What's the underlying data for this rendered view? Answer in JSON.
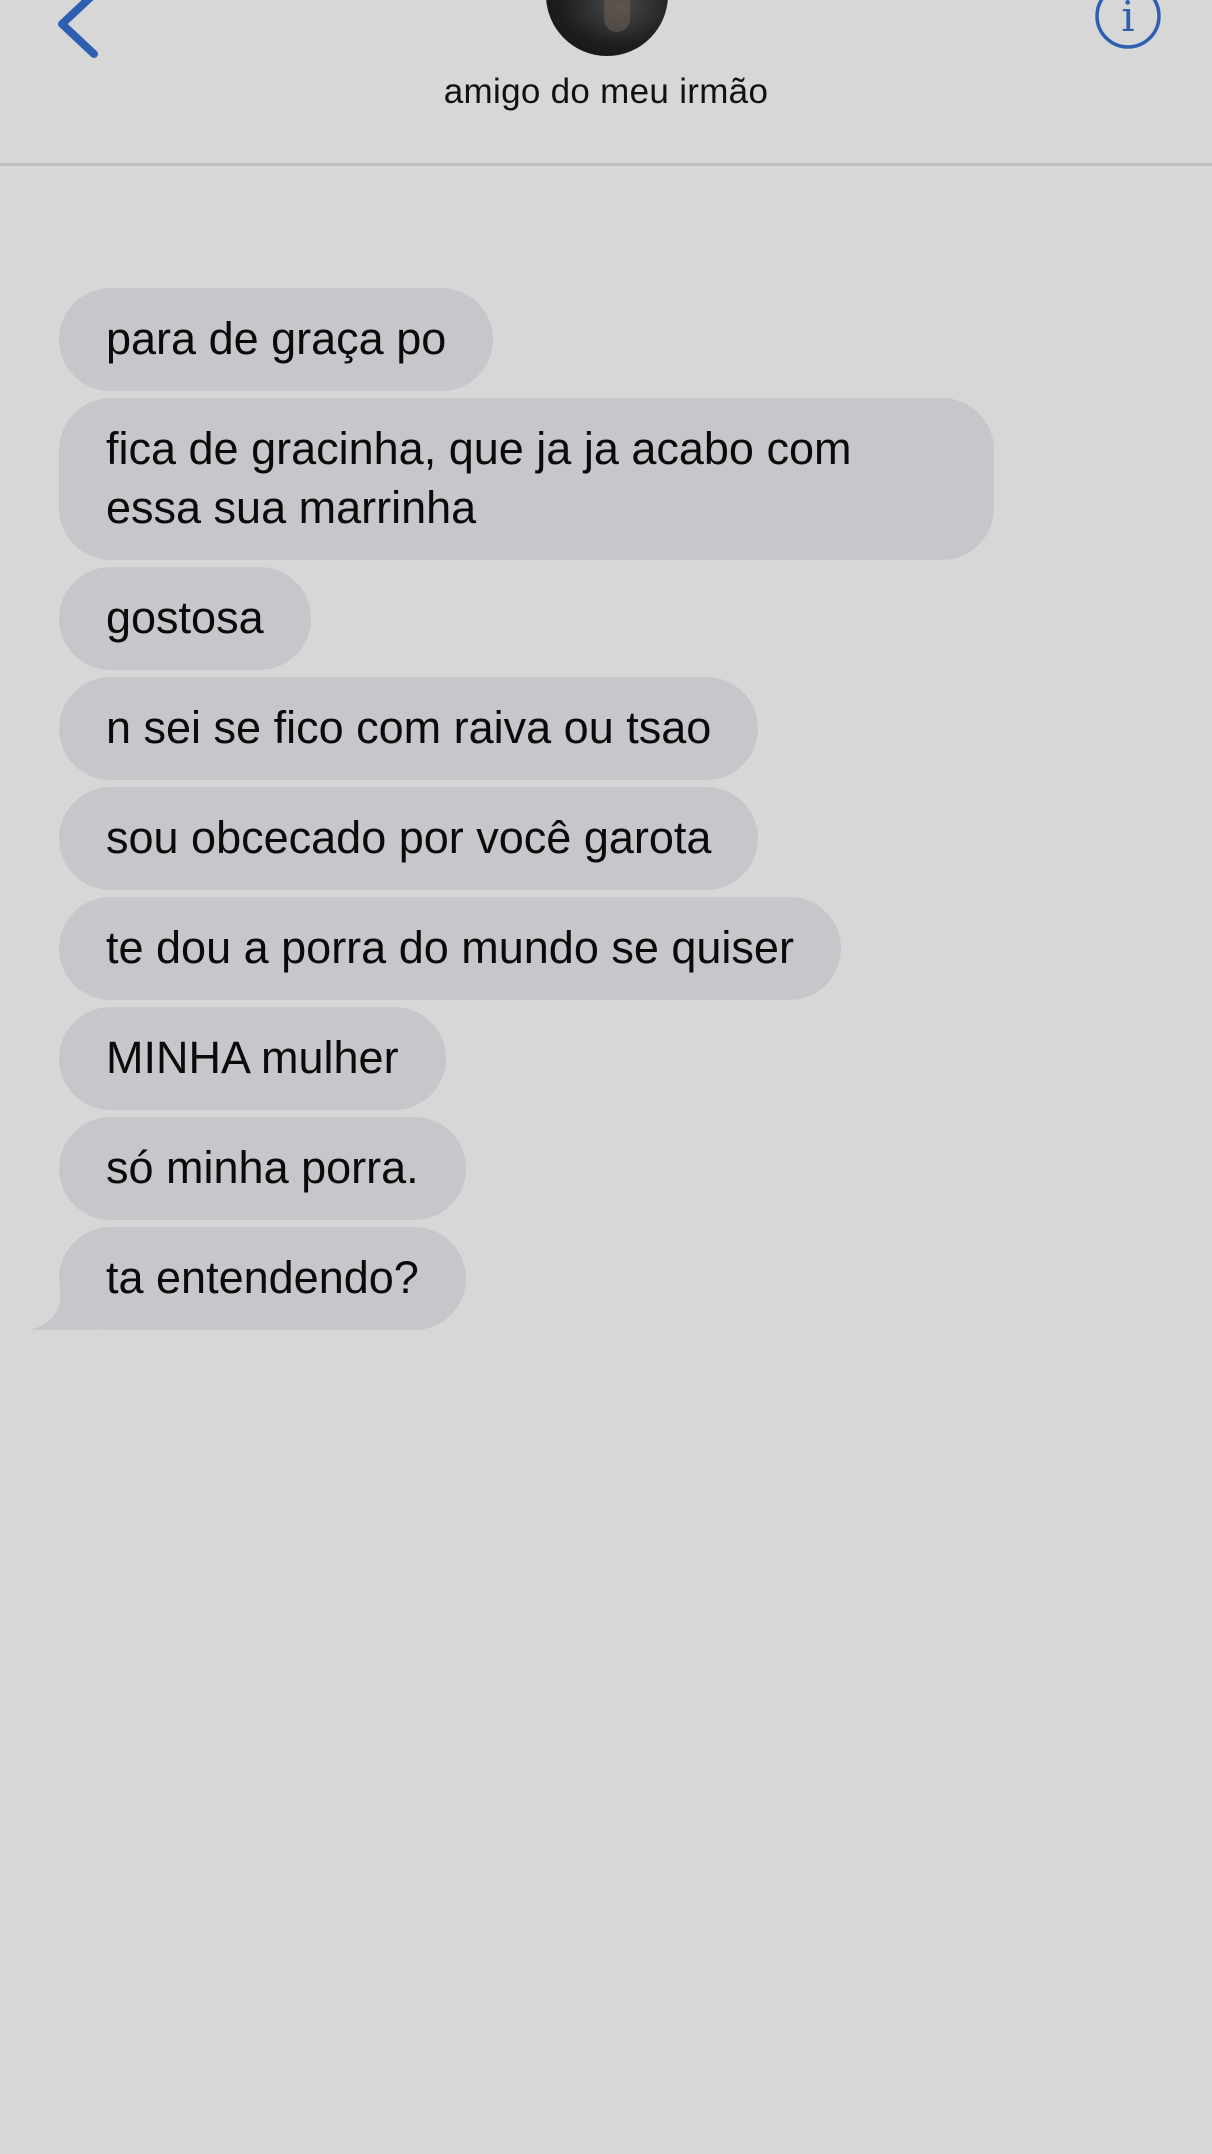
{
  "header": {
    "contact_name": "amigo do meu irmão",
    "back_icon": "chevron-left-icon",
    "info_icon": "info-icon",
    "accent_color": "#2f5fb0"
  },
  "messages": [
    {
      "text": "para de graça po"
    },
    {
      "text": "fica de gracinha, que ja ja acabo com essa sua marrinha"
    },
    {
      "text": "gostosa"
    },
    {
      "text": "n sei se fico com raiva ou tsao"
    },
    {
      "text": "sou obcecado por você garota"
    },
    {
      "text": "te dou a porra do mundo se quiser"
    },
    {
      "text": "MINHA mulher"
    },
    {
      "text": "só minha porra."
    },
    {
      "text": "ta entendendo?"
    }
  ],
  "colors": {
    "background": "#d7d7d8",
    "incoming_bubble": "#c7c6cb"
  }
}
